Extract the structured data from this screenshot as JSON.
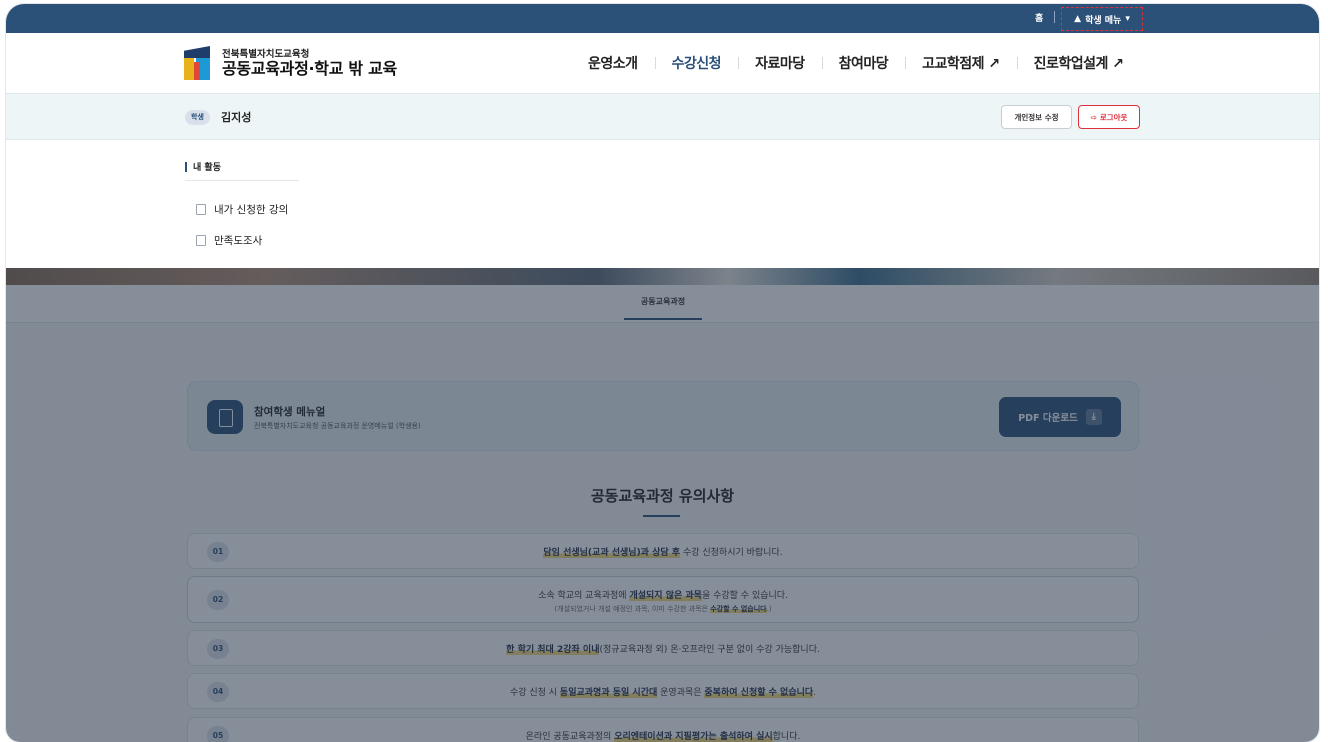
{
  "topbar": {
    "home_label": "홈",
    "student_menu_label": "학생 메뉴"
  },
  "header": {
    "logo_subtitle": "전북특별자치도교육청",
    "logo_title": "공동교육과정·학교 밖 교육",
    "nav": [
      {
        "label": "운영소개"
      },
      {
        "label": "수강신청"
      },
      {
        "label": "자료마당"
      },
      {
        "label": "참여마당"
      },
      {
        "label": "고교학점제 ↗"
      },
      {
        "label": "진로학업설계 ↗"
      }
    ]
  },
  "profile": {
    "role_badge": "학생",
    "user_name": "김지성",
    "edit_profile_label": "개인정보 수정",
    "logout_label": "로그아웃"
  },
  "dropdown": {
    "section_title": "내 활동",
    "items": [
      {
        "label": "내가 신청한 강의"
      },
      {
        "label": "만족도조사"
      }
    ]
  },
  "page": {
    "tab_label": "공동교육과정",
    "manual_title": "참여학생 메뉴얼",
    "manual_subtitle": "전북특별자치도교육청 공동교육과정 운영메뉴얼 (학생용)",
    "pdf_button_label": "PDF 다운로드",
    "notice_title": "공동교육과정 유의사항"
  },
  "notices": [
    {
      "num": "01",
      "hl1": "담임 선생님(교과 선생님)과 상담 후",
      "text1": " 수강 신청하시기 바랍니다."
    },
    {
      "num": "02",
      "pre": "소속 학교의 교육과정에 ",
      "hl1": "개설되지 않은 과목",
      "text1": "을 수강할 수 있습니다.",
      "sub_pre": "(개설되었거나 개설 예정인 과목, 이미 수강한 과목은 ",
      "sub_hl": "수강할 수 없습니다",
      "sub_post": ".)"
    },
    {
      "num": "03",
      "hl1": "한 학기 최대 2강좌 이내",
      "text1": "(정규교육과정 외) 온·오프라인 구분 없이 수강 가능합니다."
    },
    {
      "num": "04",
      "pre": "수강 신청 시 ",
      "hl1": "동일교과명과 동일 시간대",
      "text1": " 운영과목은 ",
      "hl2": "중복하여 신청할 수 없습니다",
      "text2": "."
    },
    {
      "num": "05",
      "pre": "온라인 공동교육과정의 ",
      "hl1": "오리엔테이션과 지필평가는 출석하여 실시",
      "text1": "합니다."
    }
  ],
  "colors": {
    "primary": "#2c5179",
    "accent_red": "#e0303c",
    "highlight": "#f3d97a"
  }
}
